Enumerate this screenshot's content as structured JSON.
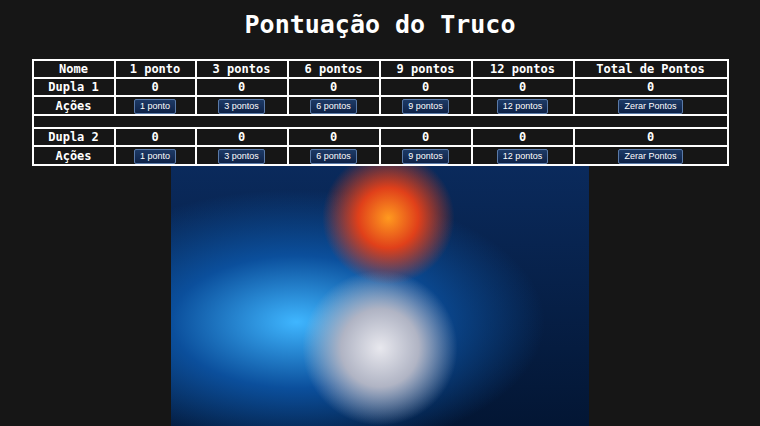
{
  "page": {
    "title": "Pontuação do Truco"
  },
  "table": {
    "columns": [
      "Nome",
      "1 ponto",
      "3 pontos",
      "6 pontos",
      "9 pontos",
      "12 pontos",
      "Total de Pontos"
    ],
    "teams": [
      {
        "name": "Dupla 1",
        "values": [
          "0",
          "0",
          "0",
          "0",
          "0"
        ],
        "total": "0",
        "actions_label": "Ações",
        "buttons": [
          "1 ponto",
          "3 pontos",
          "6 pontos",
          "9 pontos",
          "12 pontos"
        ],
        "reset_button": "Zerar Pontos"
      },
      {
        "name": "Dupla 2",
        "values": [
          "0",
          "0",
          "0",
          "0",
          "0"
        ],
        "total": "0",
        "actions_label": "Ações",
        "buttons": [
          "1 ponto",
          "3 pontos",
          "6 pontos",
          "9 pontos",
          "12 pontos"
        ],
        "reset_button": "Zerar Pontos"
      }
    ]
  }
}
